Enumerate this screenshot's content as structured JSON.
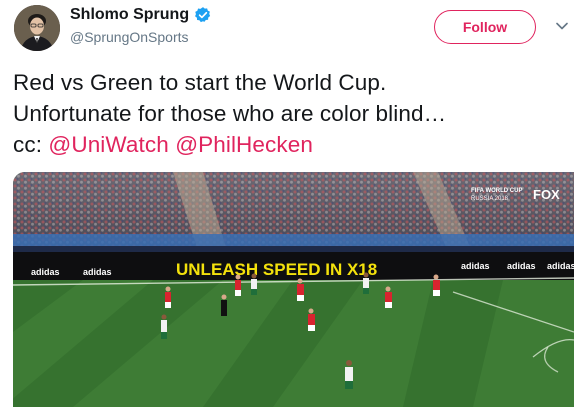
{
  "user": {
    "display_name": "Shlomo Sprung",
    "handle": "@SprungOnSports",
    "verified": true,
    "avatar_icon": "profile-photo"
  },
  "follow_button": {
    "label": "Follow",
    "color": "#e0245e"
  },
  "menu_icon": "chevron-down-icon",
  "tweet": {
    "line1": "Red vs Green to start the World Cup.",
    "line2": "Unfortunate for those who are color blind…",
    "line3_prefix": "cc: ",
    "mention1": "@UniWatch",
    "mention2": "@PhilHecken",
    "mention_color": "#e0245e"
  },
  "media": {
    "banner_text": "UNLEASH SPEED IN X18",
    "ad_brand": "adidas",
    "watermark_title": "FIFA WORLD CUP",
    "watermark_subtitle": "RUSSIA 2018",
    "broadcaster": "FOX"
  }
}
